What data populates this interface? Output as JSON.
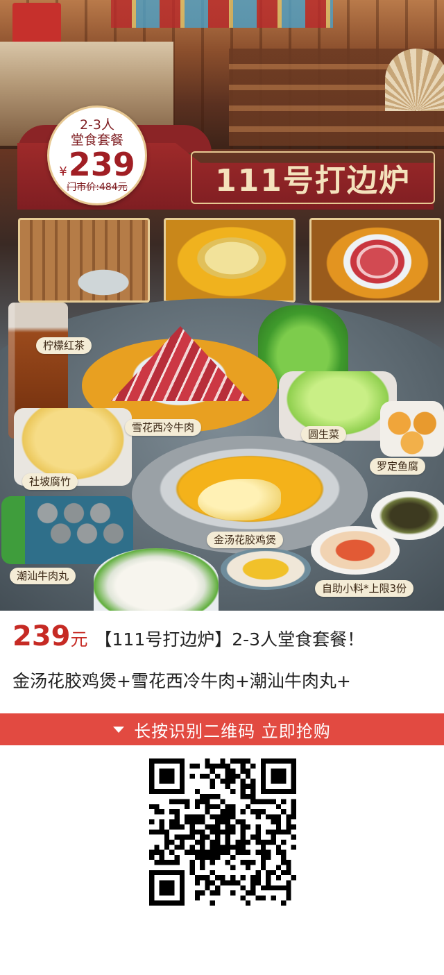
{
  "poster": {
    "price_badge": {
      "people": "2-3人",
      "meal": "堂食套餐",
      "currency": "¥",
      "price": "239",
      "original_price": "门市价:484元"
    },
    "title": "111号打边炉",
    "labels": {
      "tea": "柠檬红茶",
      "beef": "雪花西冷牛肉",
      "lettuce": "圆生菜",
      "fishball": "罗定鱼腐",
      "tofu_skin": "社坡腐竹",
      "chicken_pot": "金汤花胶鸡煲",
      "meatball": "潮汕牛肉丸",
      "sauce": "自助小料*上限3份"
    },
    "colors": {
      "brand_red": "#7f1e22",
      "gold": "#e7c892"
    }
  },
  "description": {
    "price": "239",
    "unit": "元",
    "headline": "【111号打边炉】2-3人堂食套餐！",
    "items_line": "金汤花胶鸡煲+雪花西冷牛肉+潮汕牛肉丸+"
  },
  "cta": {
    "icon": "triangle-down-icon",
    "label": "长按识别二维码 立即抢购",
    "color": "#e24a41"
  },
  "qr": {
    "icon": "qr-code"
  }
}
